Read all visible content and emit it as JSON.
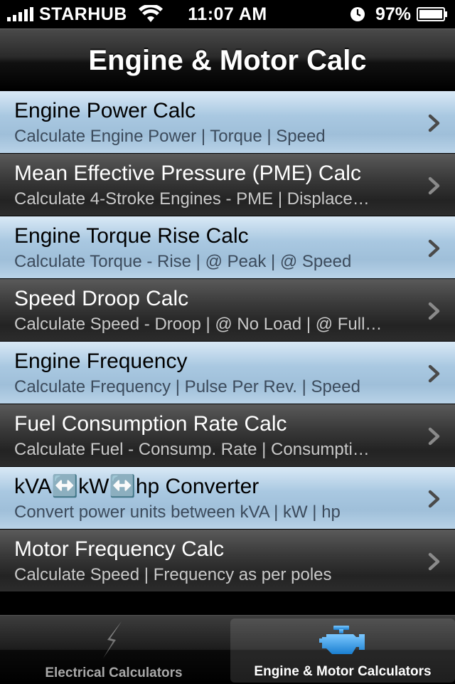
{
  "status_bar": {
    "carrier": "STARHUB",
    "time": "11:07 AM",
    "battery": "97%"
  },
  "nav": {
    "title": "Engine & Motor Calc"
  },
  "list": {
    "items": [
      {
        "title": "Engine Power Calc",
        "subtitle": "Calculate Engine Power | Torque | Speed",
        "style": "blue"
      },
      {
        "title": "Mean Effective Pressure (PME) Calc",
        "subtitle": "Calculate 4-Stroke Engines - PME | Displace…",
        "style": "dark"
      },
      {
        "title": "Engine Torque Rise Calc",
        "subtitle": "Calculate Torque - Rise | @ Peak | @ Speed",
        "style": "blue"
      },
      {
        "title": "Speed Droop Calc",
        "subtitle": "Calculate Speed - Droop | @ No Load | @ Full…",
        "style": "dark"
      },
      {
        "title": "Engine Frequency",
        "subtitle": "Calculate Frequency | Pulse Per Rev. | Speed",
        "style": "blue"
      },
      {
        "title": "Fuel Consumption Rate Calc",
        "subtitle": "Calculate Fuel - Consump. Rate | Consumpti…",
        "style": "dark"
      },
      {
        "title": "kVA↔️kW↔️hp Converter",
        "subtitle": "Convert power units between kVA | kW | hp",
        "style": "blue"
      },
      {
        "title": "Motor Frequency Calc",
        "subtitle": "Calculate Speed | Frequency as per poles",
        "style": "dark"
      }
    ]
  },
  "tab_bar": {
    "tabs": [
      {
        "label": "Electrical Calculators",
        "icon": "lightning-bolt-icon",
        "selected": false
      },
      {
        "label": "Engine & Motor Calculators",
        "icon": "engine-icon",
        "selected": true
      }
    ]
  },
  "colors": {
    "row_blue": "#a9c8e1",
    "row_dark": "#2e2e2e",
    "accent_engine_icon": "#2d9be8"
  }
}
